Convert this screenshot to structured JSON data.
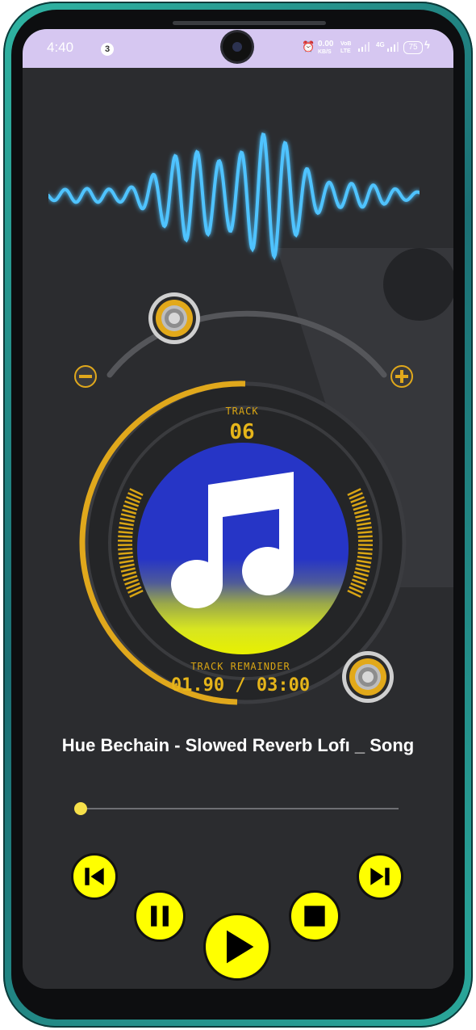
{
  "status_bar": {
    "time": "4:40",
    "notification_count": "3",
    "net_speed_value": "0.00",
    "net_speed_unit": "KB/S",
    "volte": "VoB",
    "volte2": "LTE",
    "lte": "4G",
    "battery": "75"
  },
  "player": {
    "track_label": "TRACK",
    "track_number": "06",
    "remainder_label": "TRACK REMAINDER",
    "remainder_time": "01.90 / 03:00",
    "song_title": "Hue Bechain - Slowed Reverb Lofı _ Song",
    "progress_fraction": 0.0
  },
  "controls": {
    "previous": "skip-previous-icon",
    "pause": "pause-icon",
    "play": "play-icon",
    "stop": "stop-icon",
    "next": "skip-next-icon"
  },
  "colors": {
    "accent": "#ffff00",
    "dial_gold": "#e0a81c",
    "wave_blue": "#4fc3ff",
    "status_bar": "#d6c7f1",
    "background": "#2b2c2f"
  }
}
